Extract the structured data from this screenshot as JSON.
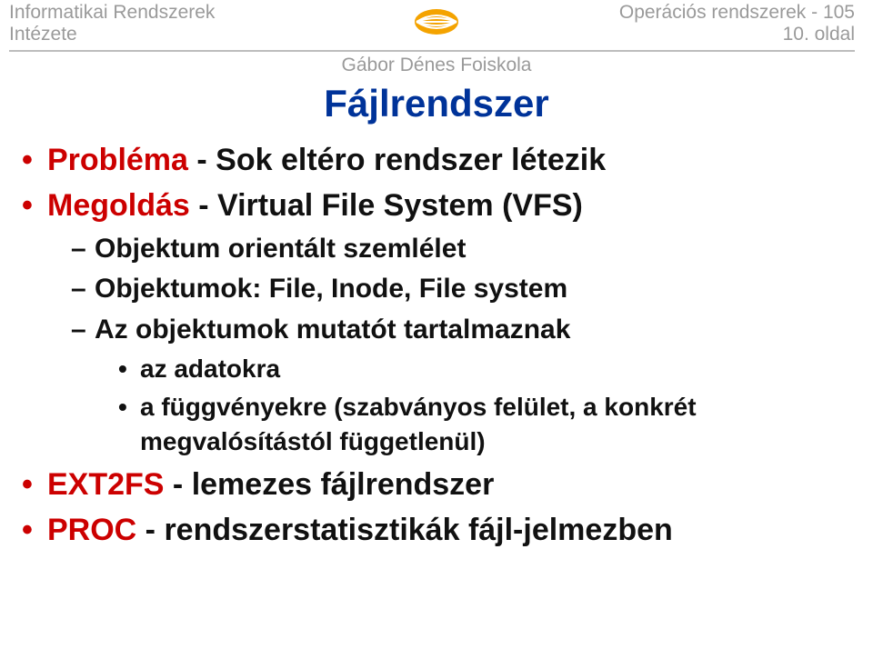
{
  "header": {
    "left_line1": "Informatikai Rendszerek",
    "left_line2": "Intézete",
    "right_line1": "Operációs rendszerek - 105",
    "right_line2": "10. oldal",
    "school": "Gábor Dénes Foiskola"
  },
  "slide": {
    "title": "Fájlrendszer",
    "items": [
      {
        "lead": "Probléma",
        "rest": " - Sok eltéro rendszer létezik"
      },
      {
        "lead": "Megoldás",
        "rest": " - Virtual File System (VFS)",
        "sub": [
          {
            "text": "Objektum orientált szemlélet"
          },
          {
            "text": "Objektumok: File, Inode, File system"
          },
          {
            "text": "Az objektumok mutatót tartalmaznak",
            "sub": [
              {
                "text": "az adatokra"
              },
              {
                "text": "a függvényekre (szabványos felület, a konkrét megvalósítástól függetlenül)"
              }
            ]
          }
        ]
      },
      {
        "lead": "EXT2FS",
        "rest": " - lemezes fájlrendszer"
      },
      {
        "lead": "PROC",
        "rest": " - rendszerstatisztikák fájl-jelmezben"
      }
    ]
  }
}
